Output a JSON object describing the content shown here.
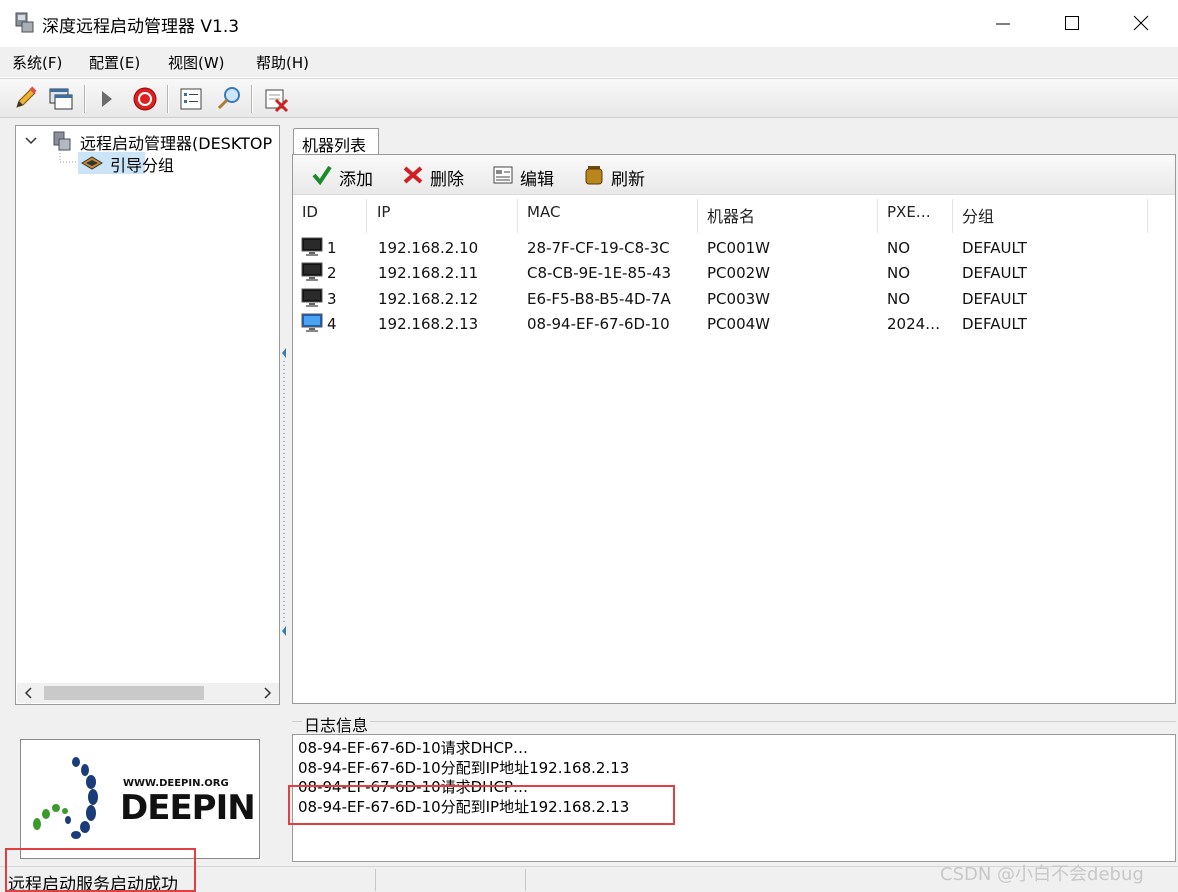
{
  "window": {
    "title": "深度远程启动管理器 V1.3"
  },
  "menu": [
    {
      "label": "系统(F)"
    },
    {
      "label": "配置(E)"
    },
    {
      "label": "视图(W)"
    },
    {
      "label": "帮助(H)"
    }
  ],
  "toolbar": {
    "icons": [
      "pencil-icon",
      "window-icon",
      "play-icon",
      "stop-icon",
      "properties-icon",
      "search-icon",
      "delete-icon"
    ]
  },
  "tree": {
    "root_label": "远程启动管理器(DESKTOP",
    "child_label": "引导分组"
  },
  "tab": {
    "label": "机器列表"
  },
  "list_toolbar": {
    "add_label": "添加",
    "delete_label": "删除",
    "edit_label": "编辑",
    "refresh_label": "刷新"
  },
  "table": {
    "columns": [
      "ID",
      "IP",
      "MAC",
      "机器名",
      "PXE…",
      "分组"
    ],
    "rows": [
      {
        "id": "1",
        "ip": "192.168.2.10",
        "mac": "28-7F-CF-19-C8-3C",
        "name": "PC001W",
        "pxe": "NO",
        "group": "DEFAULT",
        "icon": "monitor-off-icon"
      },
      {
        "id": "2",
        "ip": "192.168.2.11",
        "mac": "C8-CB-9E-1E-85-43",
        "name": "PC002W",
        "pxe": "NO",
        "group": "DEFAULT",
        "icon": "monitor-off-icon"
      },
      {
        "id": "3",
        "ip": "192.168.2.12",
        "mac": "E6-F5-B8-B5-4D-7A",
        "name": "PC003W",
        "pxe": "NO",
        "group": "DEFAULT",
        "icon": "monitor-off-icon"
      },
      {
        "id": "4",
        "ip": "192.168.2.13",
        "mac": "08-94-EF-67-6D-10",
        "name": "PC004W",
        "pxe": "2024…",
        "group": "DEFAULT",
        "icon": "monitor-on-icon"
      }
    ]
  },
  "log": {
    "title": "日志信息",
    "lines": [
      "08-94-EF-67-6D-10请求DHCP…",
      "08-94-EF-67-6D-10分配到IP地址192.168.2.13",
      "08-94-EF-67-6D-10请求DHCP…",
      "08-94-EF-67-6D-10分配到IP地址192.168.2.13"
    ]
  },
  "logo": {
    "url_text": "WWW.DEEPIN.ORG",
    "brand_text": "DEEPIN"
  },
  "status": {
    "text": "远程启动服务启动成功"
  },
  "watermark": {
    "text": "CSDN @小白不会debug"
  }
}
